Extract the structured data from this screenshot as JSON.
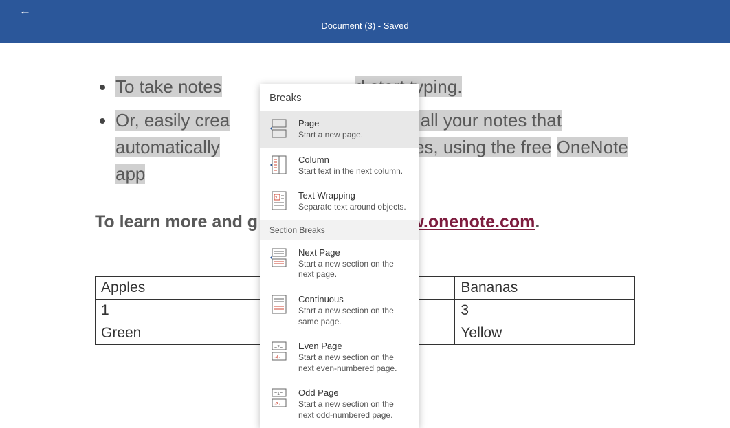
{
  "header": {
    "title": "Document (3) - Saved"
  },
  "content": {
    "bullet1_a": "To take notes",
    "bullet1_b": "d start typing.",
    "bullet2_a": "Or, easily crea",
    "bullet2_b": "ook for all your notes that",
    "bullet2_c": "automatically",
    "bullet2_d": "r devices, using the free",
    "bullet2_e": "OneNote app",
    "learn": "To learn more and g",
    "link": "ww.onenote.com",
    "dot": "."
  },
  "table": {
    "r1": [
      "Apples",
      "",
      "Bananas"
    ],
    "r2": [
      "1",
      "",
      "3"
    ],
    "r3": [
      "Green",
      "",
      "Yellow"
    ]
  },
  "menu": {
    "header": "Breaks",
    "page_breaks": [
      {
        "title": "Page",
        "desc": "Start a new page.",
        "icon": "page-icon",
        "hover": true
      },
      {
        "title": "Column",
        "desc": "Start text in the next column.",
        "icon": "column-icon"
      },
      {
        "title": "Text Wrapping",
        "desc": "Separate text around objects.",
        "icon": "wrap-icon"
      }
    ],
    "section_header": "Section Breaks",
    "section_breaks": [
      {
        "title": "Next Page",
        "desc": "Start a new section on the next page.",
        "icon": "nextpage-icon"
      },
      {
        "title": "Continuous",
        "desc": "Start a new section on the same page.",
        "icon": "continuous-icon"
      },
      {
        "title": "Even Page",
        "desc": "Start a new section on the next even-numbered page.",
        "icon": "evenpage-icon"
      },
      {
        "title": "Odd Page",
        "desc": "Start a new section on the next odd-numbered page.",
        "icon": "oddpage-icon"
      }
    ]
  }
}
